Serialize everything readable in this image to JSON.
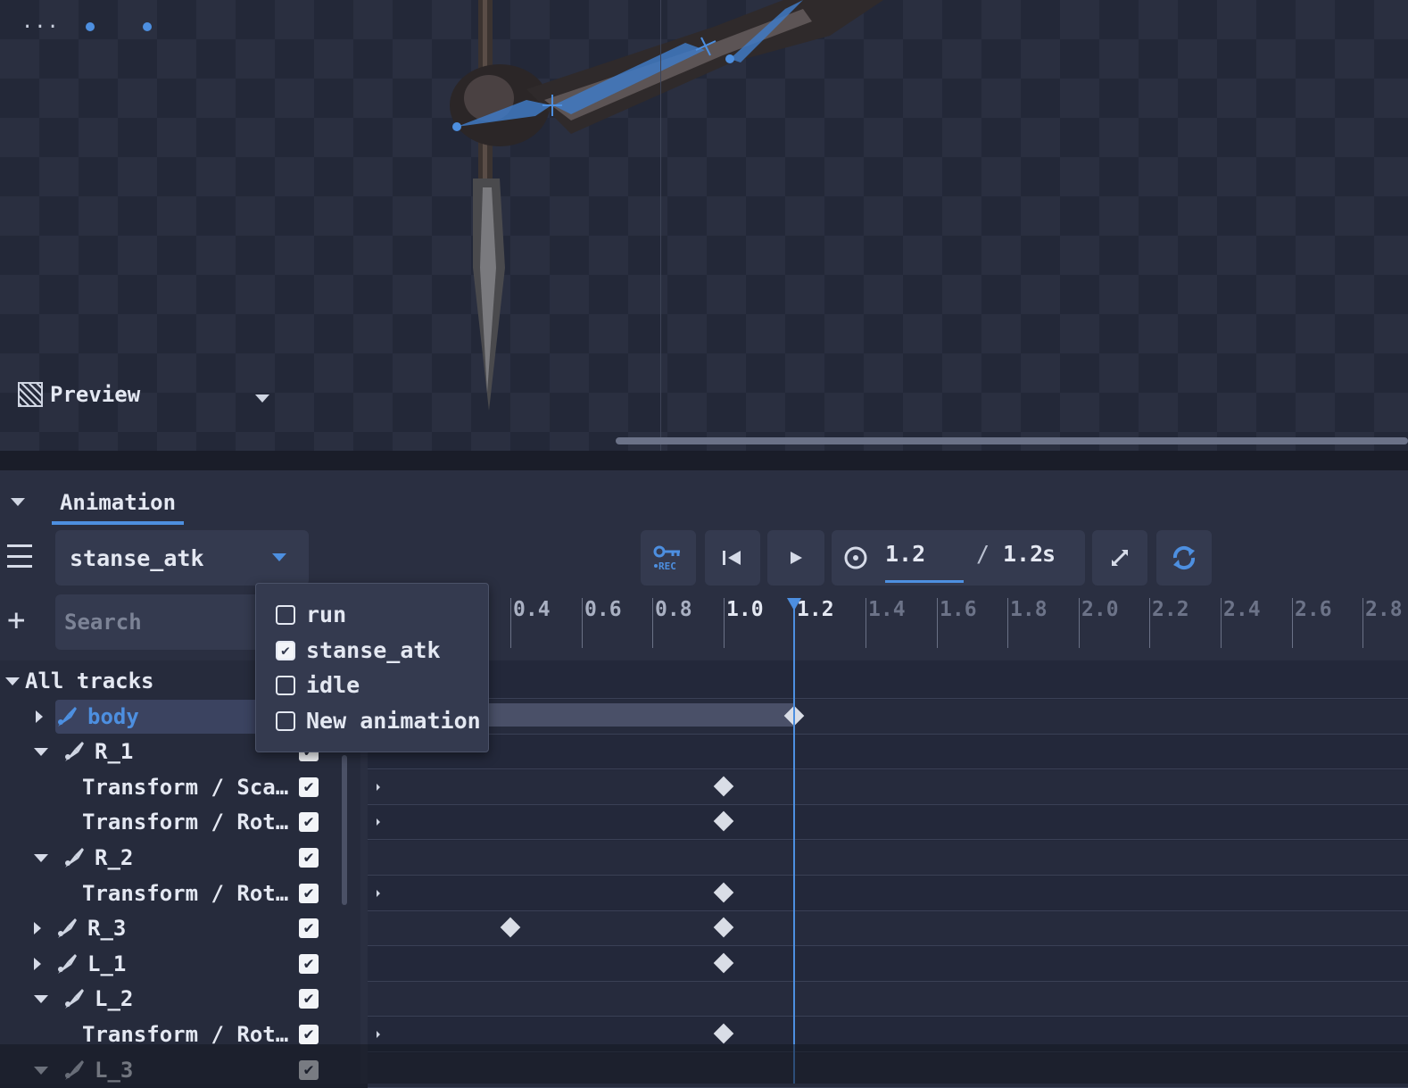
{
  "viewport": {
    "menu_icon": "ellipsis-icon",
    "preview_label": "Preview"
  },
  "panel": {
    "tab_label": "Animation",
    "animation_select": {
      "value": "stanse_atk"
    },
    "search": {
      "placeholder": "Search"
    },
    "toolbar": {
      "rec_label": "REC",
      "time_current": "1.2",
      "time_separator": "/",
      "time_total": "1.2",
      "time_unit": "s"
    },
    "ruler_ticks": [
      "0.4",
      "0.6",
      "0.8",
      "1.0",
      "1.2",
      "1.4",
      "1.6",
      "1.8",
      "2.0",
      "2.2",
      "2.4",
      "2.6",
      "2.8"
    ],
    "playhead_time": 1.2,
    "tracks": [
      {
        "label": "All tracks",
        "expanded": true,
        "level": 0
      },
      {
        "label": "body",
        "expanded": false,
        "level": 1,
        "bone": true,
        "selected": true
      },
      {
        "label": "R_1",
        "expanded": true,
        "level": 1,
        "bone": true,
        "checked": true
      },
      {
        "label": "Transform / Sca…",
        "level": 2,
        "checked": true
      },
      {
        "label": "Transform / Rot…",
        "level": 2,
        "checked": true
      },
      {
        "label": "R_2",
        "expanded": true,
        "level": 1,
        "bone": true,
        "checked": true
      },
      {
        "label": "Transform / Rot…",
        "level": 2,
        "checked": true
      },
      {
        "label": "R_3",
        "expanded": false,
        "level": 1,
        "bone": true,
        "checked": true
      },
      {
        "label": "L_1",
        "expanded": false,
        "level": 1,
        "bone": true,
        "checked": true
      },
      {
        "label": "L_2",
        "expanded": true,
        "level": 1,
        "bone": true,
        "checked": true
      },
      {
        "label": "Transform / Rot…",
        "level": 2,
        "checked": true
      },
      {
        "label": "L_3",
        "expanded": true,
        "level": 1,
        "bone": true,
        "checked": true
      }
    ],
    "popup_items": [
      {
        "label": "run",
        "checked": false
      },
      {
        "label": "stanse_atk",
        "checked": true
      },
      {
        "label": "idle",
        "checked": false
      },
      {
        "label": "New animation",
        "checked": false
      }
    ]
  },
  "colors": {
    "accent": "#4d8fe0",
    "panel_bg": "#2a2f41",
    "viewport_bg": "#232838"
  }
}
